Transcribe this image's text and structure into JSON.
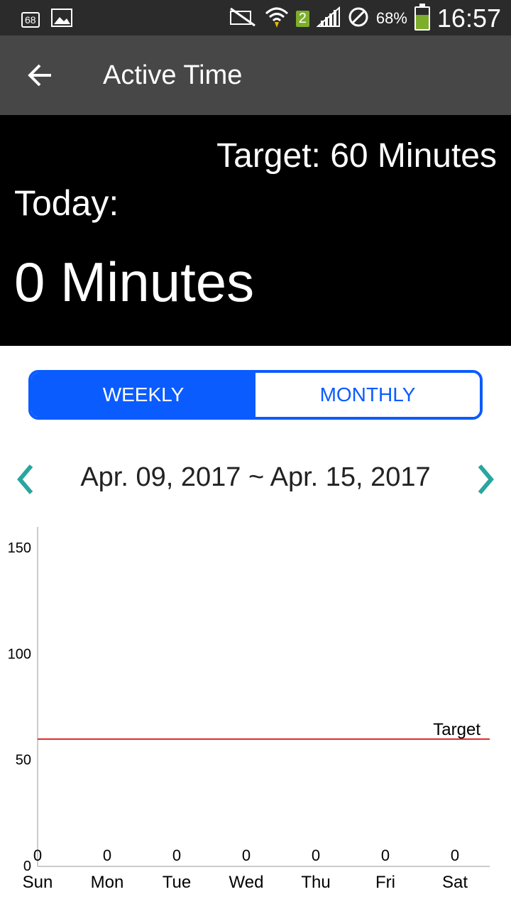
{
  "status_bar": {
    "notification_badge": "68",
    "sim_slot": "2",
    "battery_percent": "68%",
    "battery_level": 0.68,
    "time": "16:57",
    "icons": [
      "notification-badge-icon",
      "image-icon",
      "nfc-muted-icon",
      "wifi-icon",
      "signal-icon",
      "do-not-disturb-icon",
      "battery-icon"
    ]
  },
  "app_bar": {
    "title": "Active Time",
    "back_icon": "arrow-left-icon"
  },
  "summary": {
    "target_label": "Target: 60 Minutes",
    "today_label": "Today:",
    "today_value": "0 Minutes"
  },
  "toggle": {
    "weekly_label": "WEEKLY",
    "monthly_label": "MONTHLY",
    "selected": "WEEKLY",
    "accent_color": "#0a5cff"
  },
  "date_range": {
    "text": "Apr. 09, 2017 ~ Apr. 15, 2017",
    "prev_icon": "chevron-left-icon",
    "next_icon": "chevron-right-icon",
    "arrow_color": "#2aa5a0"
  },
  "chart_data": {
    "type": "bar",
    "categories": [
      "Sun",
      "Mon",
      "Tue",
      "Wed",
      "Thu",
      "Fri",
      "Sat"
    ],
    "values": [
      0,
      0,
      0,
      0,
      0,
      0,
      0
    ],
    "value_labels": [
      "0",
      "0",
      "0",
      "0",
      "0",
      "0",
      "0"
    ],
    "y_ticks": [
      0,
      50,
      100,
      150
    ],
    "ylim": [
      0,
      160
    ],
    "target": {
      "value": 60,
      "label": "Target",
      "color": "#e02020"
    },
    "grid": false
  }
}
